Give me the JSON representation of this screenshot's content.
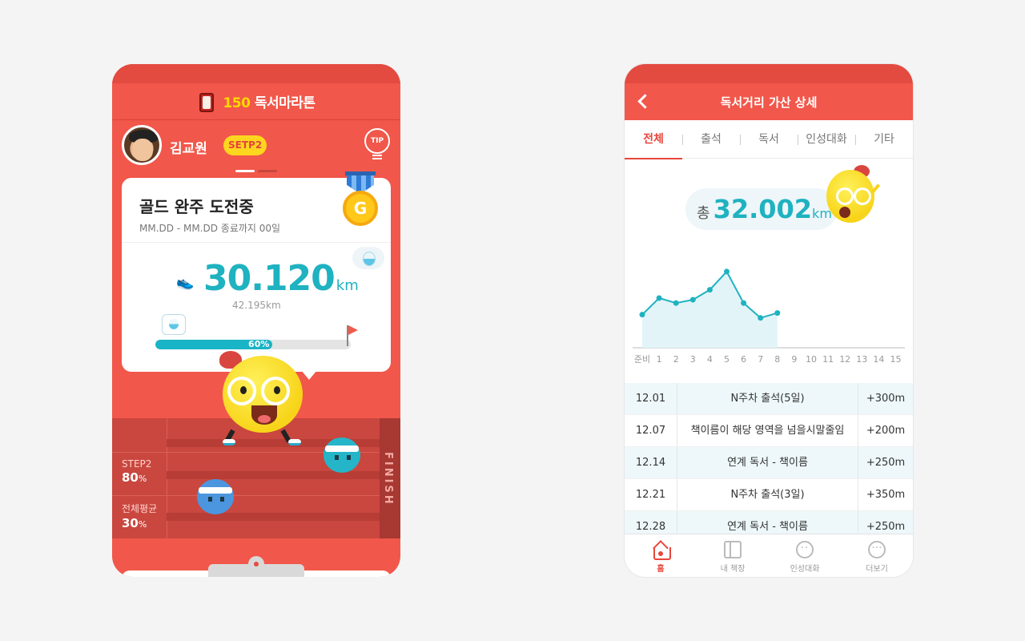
{
  "left_screen": {
    "logo": {
      "number": "150",
      "text": "독서마라톤"
    },
    "profile": {
      "name": "김교원",
      "step_badge": "SETP2",
      "tip_label": "TIP"
    },
    "card": {
      "title": "골드 완주 도전중",
      "subtitle": "MM.DD - MM.DD 종료까지 00일",
      "medal_letter": "G",
      "distance_value": "30.120",
      "distance_unit": "km",
      "distance_total": "42.195km",
      "progress_label": "60%",
      "progress_fraction": 0.6
    },
    "track": {
      "finish_label": "FINISH",
      "step2_label": "STEP2",
      "step2_value": "80",
      "avg_label": "전체평균",
      "avg_value": "30",
      "percent_sign": "%"
    }
  },
  "right_screen": {
    "title": "독서거리 가산 상세",
    "tabs": [
      {
        "label": "전체"
      },
      {
        "label": "출석"
      },
      {
        "label": "독서"
      },
      {
        "label": "인성대화"
      },
      {
        "label": "기타"
      }
    ],
    "total": {
      "prefix": "총",
      "value": "32.002",
      "unit": "km"
    },
    "table": [
      {
        "date": "12.01",
        "desc": "N주차 출석(5일)",
        "amount": "+300m"
      },
      {
        "date": "12.07",
        "desc": "책이름이 해당 영역을 넘을시말줄임",
        "amount": "+200m"
      },
      {
        "date": "12.14",
        "desc": "연계 독서 - 책이름",
        "amount": "+250m"
      },
      {
        "date": "12.21",
        "desc": "N주차 출석(3일)",
        "amount": "+350m"
      },
      {
        "date": "12.28",
        "desc": "연계 독서 - 책이름",
        "amount": "+250m"
      }
    ],
    "nav": [
      {
        "label": "홈"
      },
      {
        "label": "내 책장"
      },
      {
        "label": "인성대화"
      },
      {
        "label": "더보기"
      }
    ]
  },
  "chart_data": {
    "type": "area",
    "categories": [
      "준비",
      "1",
      "2",
      "3",
      "4",
      "5",
      "6",
      "7",
      "8",
      "9",
      "10",
      "11",
      "12",
      "13",
      "14",
      "15"
    ],
    "values": [
      2.0,
      3.0,
      2.7,
      2.9,
      3.5,
      4.6,
      2.7,
      1.8,
      2.1
    ],
    "ylim": [
      0,
      6
    ],
    "color": "#1fb2c0",
    "fill": "#e2f4f8"
  }
}
